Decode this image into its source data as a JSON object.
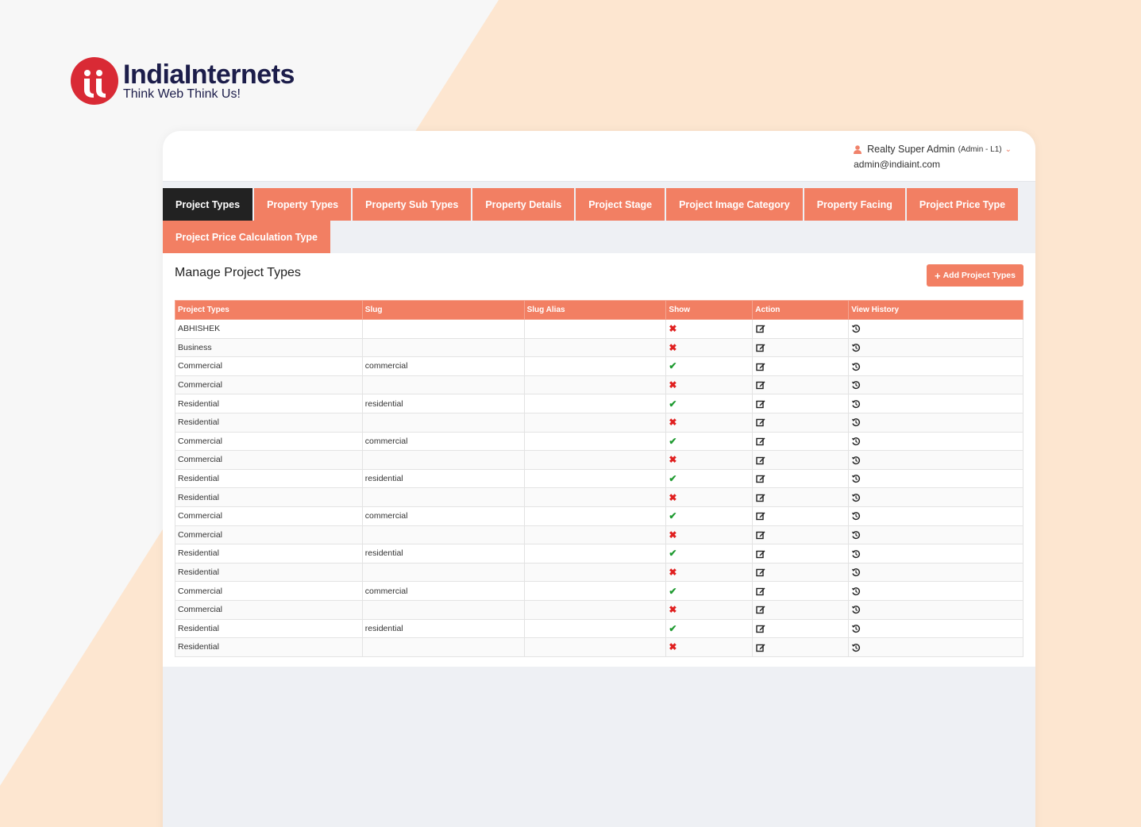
{
  "brand": {
    "name": "IndiaInternets",
    "tagline": "Think Web Think Us!",
    "accent": "#f27f63",
    "logo_red": "#d92a35",
    "navy": "#1c1d4a"
  },
  "user": {
    "name": "Realty Super Admin",
    "role": "(Admin - L1)",
    "email": "admin@indiaint.com"
  },
  "tabs": [
    {
      "label": "Project Types",
      "active": true
    },
    {
      "label": "Property Types"
    },
    {
      "label": "Property Sub Types"
    },
    {
      "label": "Property Details"
    },
    {
      "label": "Project Stage"
    },
    {
      "label": "Project Image Category"
    },
    {
      "label": "Property Facing"
    },
    {
      "label": "Project Price Type"
    },
    {
      "label": "Project Price Calculation Type"
    }
  ],
  "page": {
    "title": "Manage Project Types",
    "add_button": "Add Project Types"
  },
  "table": {
    "headers": [
      "Project Types",
      "Slug",
      "Slug Alias",
      "Show",
      "Action",
      "View History"
    ],
    "rows": [
      {
        "type": "ABHISHEK",
        "slug": "",
        "alias": "",
        "show": false
      },
      {
        "type": "Business",
        "slug": "",
        "alias": "",
        "show": false
      },
      {
        "type": "Commercial",
        "slug": "commercial",
        "alias": "",
        "show": true
      },
      {
        "type": "Commercial",
        "slug": "",
        "alias": "",
        "show": false
      },
      {
        "type": "Residential",
        "slug": "residential",
        "alias": "",
        "show": true
      },
      {
        "type": "Residential",
        "slug": "",
        "alias": "",
        "show": false
      },
      {
        "type": "Commercial",
        "slug": "commercial",
        "alias": "",
        "show": true
      },
      {
        "type": "Commercial",
        "slug": "",
        "alias": "",
        "show": false
      },
      {
        "type": "Residential",
        "slug": "residential",
        "alias": "",
        "show": true
      },
      {
        "type": "Residential",
        "slug": "",
        "alias": "",
        "show": false
      },
      {
        "type": "Commercial",
        "slug": "commercial",
        "alias": "",
        "show": true
      },
      {
        "type": "Commercial",
        "slug": "",
        "alias": "",
        "show": false
      },
      {
        "type": "Residential",
        "slug": "residential",
        "alias": "",
        "show": true
      },
      {
        "type": "Residential",
        "slug": "",
        "alias": "",
        "show": false
      },
      {
        "type": "Commercial",
        "slug": "commercial",
        "alias": "",
        "show": true
      },
      {
        "type": "Commercial",
        "slug": "",
        "alias": "",
        "show": false
      },
      {
        "type": "Residential",
        "slug": "residential",
        "alias": "",
        "show": true
      },
      {
        "type": "Residential",
        "slug": "",
        "alias": "",
        "show": false
      }
    ],
    "icons": {
      "show_true": "check-icon",
      "show_false": "cross-icon",
      "action": "edit-icon",
      "history": "history-icon"
    }
  }
}
